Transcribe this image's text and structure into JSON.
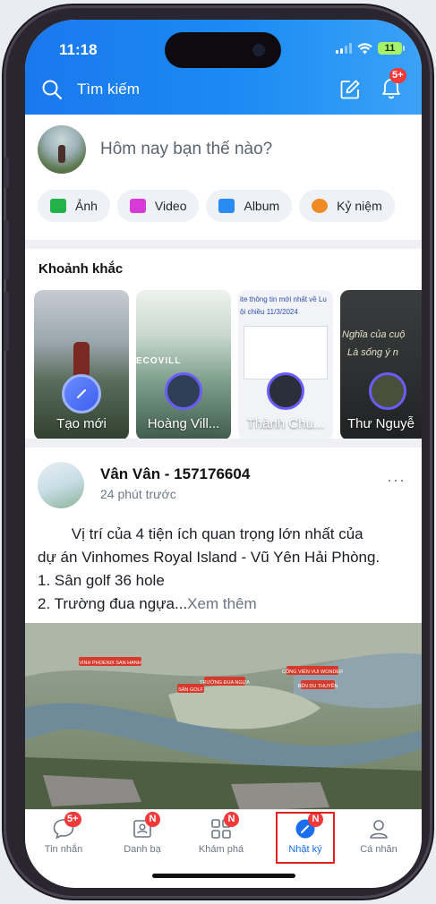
{
  "status_bar": {
    "time": "11:18",
    "battery": "11"
  },
  "header": {
    "search_placeholder": "Tìm kiếm",
    "notification_badge": "5+"
  },
  "composer": {
    "prompt": "Hôm nay bạn thế nào?",
    "chips": [
      {
        "label": "Ảnh",
        "icon": "photo-icon",
        "color": "#22b24c"
      },
      {
        "label": "Video",
        "icon": "video-icon",
        "color": "#d83ad8"
      },
      {
        "label": "Album",
        "icon": "album-icon",
        "color": "#2a8cf2"
      },
      {
        "label": "Kỷ niệm",
        "icon": "memory-icon",
        "color": "#f08a24"
      }
    ]
  },
  "moments": {
    "title": "Khoảnh khắc",
    "stories": [
      {
        "label": "Tạo mới"
      },
      {
        "label": "Hoàng Vill..."
      },
      {
        "label": "Thành Chu..."
      },
      {
        "label": "Thư Nguyễ"
      }
    ],
    "story_texts": {
      "story2_card": "ECOVILL",
      "story3_headline": "ite thông tin mới nhất về Lu",
      "story3_subline": "ội chiều 11/3/2024",
      "story4_script": "Nghĩa của cuộ",
      "story4_script2": "Là sống ý n"
    }
  },
  "post": {
    "author": "Vân Vân - 157176604",
    "time": "24 phút trước",
    "more": "···",
    "lines": [
      "        Vị trí của 4 tiện ích quan trọng lớn nhất của",
      "dự án Vinhomes Royal Island - Vũ Yên Hải Phòng.",
      "1. Sân golf 36 hole",
      "2. Trường đua ngựa..."
    ],
    "see_more": "Xem thêm",
    "map_labels": [
      "VINH PHOENIX SAN HANH",
      "SÂN GOLF",
      "TRƯỜNG ĐUA NGỰA",
      "CÔNG VIÊN VUI WONDER",
      "BẾN DU THUYỀN"
    ]
  },
  "tabbar": {
    "tabs": [
      {
        "label": "Tin nhắn",
        "badge": "5+",
        "icon": "chat-icon"
      },
      {
        "label": "Danh bạ",
        "badge": "N",
        "icon": "contacts-icon"
      },
      {
        "label": "Khám phá",
        "badge": "N",
        "icon": "discover-icon"
      },
      {
        "label": "Nhật ký",
        "badge": "N",
        "icon": "timeline-icon",
        "active": true
      },
      {
        "label": "Cá nhân",
        "badge": "",
        "icon": "profile-icon"
      }
    ]
  },
  "colors": {
    "accent": "#1a78ee",
    "badge": "#f23a3a",
    "highlight": "#e0211e"
  }
}
